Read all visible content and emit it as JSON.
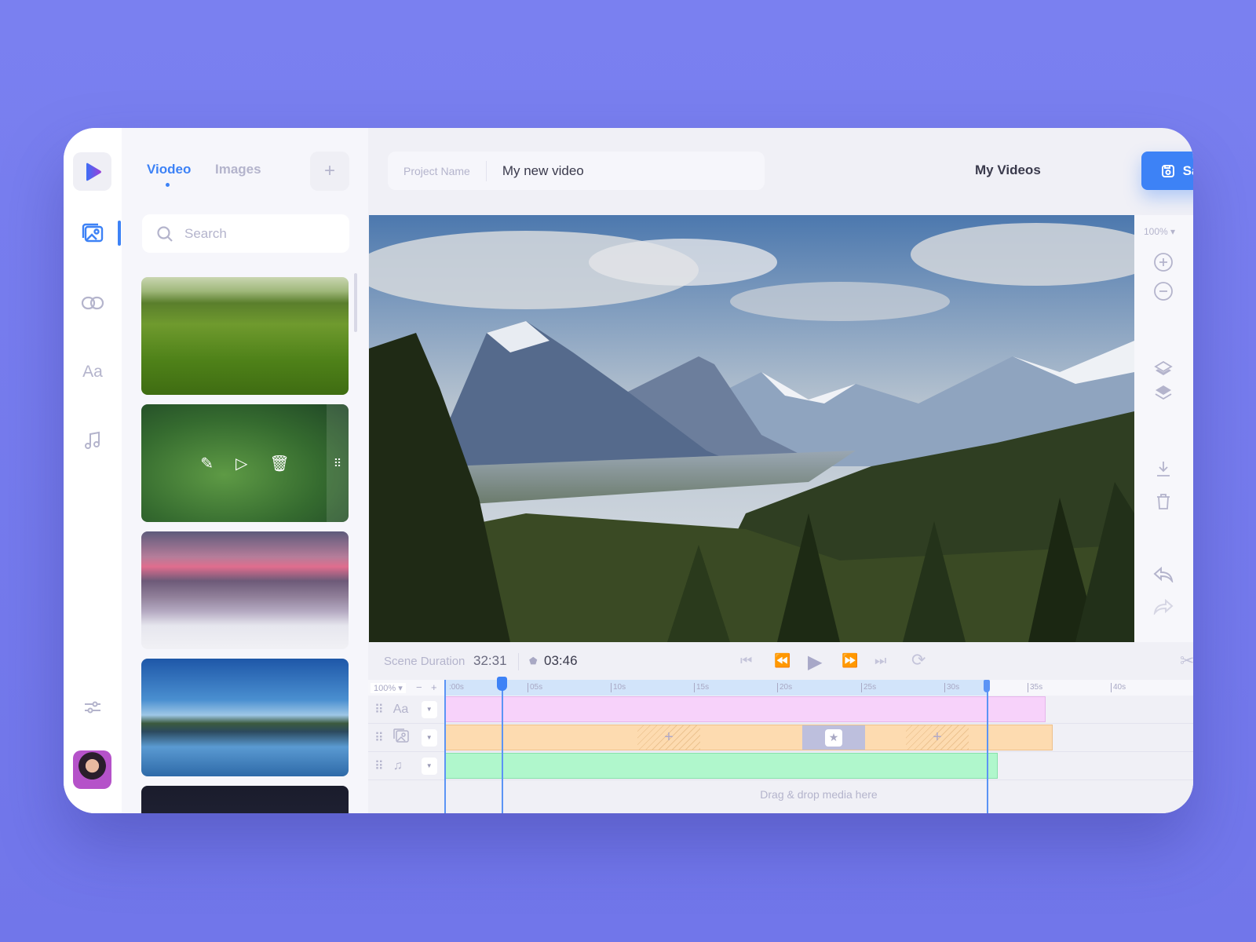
{
  "sidebar": {
    "items": [
      "media-icon",
      "link-icon",
      "text-icon",
      "music-icon"
    ],
    "text_icon_label": "Aa",
    "settings": "sliders-icon"
  },
  "media_panel": {
    "tabs": [
      {
        "label": "Viodeo",
        "active": true
      },
      {
        "label": "Images",
        "active": false
      }
    ],
    "add_label": "+",
    "search_placeholder": "Search"
  },
  "header": {
    "project_label": "Project Name",
    "project_name": "My new video",
    "my_videos": "My Videos",
    "save": "Save"
  },
  "tools": {
    "zoom": "100%"
  },
  "controls": {
    "scene_label": "Scene Duration",
    "scene_duration": "32:31",
    "current_time": "03:46"
  },
  "timeline": {
    "zoom": "100%",
    "minus": "−",
    "plus": "+",
    "ticks": [
      ":00s",
      "05s",
      "10s",
      "15s",
      "20s",
      "25s",
      "30s",
      "35s",
      "40s"
    ],
    "track_text_label": "Aa",
    "dropzone": "Drag & drop media here",
    "playhead_seconds": 3.46,
    "end_marker_seconds": 32.31
  },
  "colors": {
    "accent": "#3d82f6",
    "text_track": "#f7d2fa",
    "image_track": "#fddbb0",
    "audio_track": "#b0f7cc",
    "background": "#7a80f0"
  }
}
